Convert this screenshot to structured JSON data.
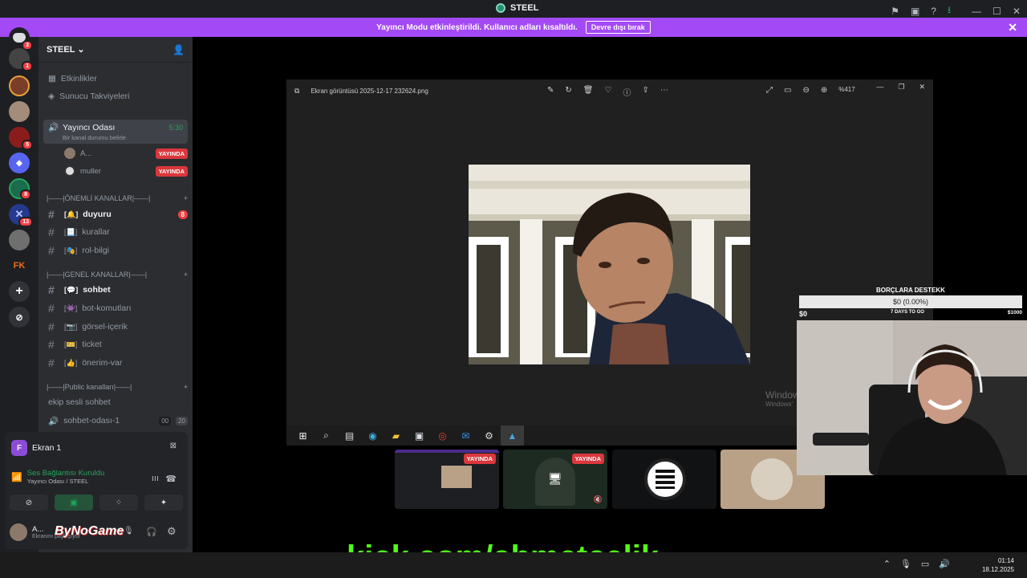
{
  "window": {
    "title": "STEEL"
  },
  "banner": {
    "text": "Yayıncı Modu etkinleştirildi. Kullanıcı adları kısaltıldı.",
    "button": "Devre dışı bırak"
  },
  "guilds": [
    {
      "badge": "3",
      "color": "#5865f2",
      "label": "D"
    },
    {
      "badge": "1",
      "color": "#3a3a3a",
      "label": ""
    },
    {
      "badge": "",
      "color": "#6b3030",
      "label": ""
    },
    {
      "badge": "",
      "color": "#8a6a50",
      "label": ""
    },
    {
      "badge": "5",
      "color": "#7a1515",
      "label": ""
    },
    {
      "badge": "",
      "color": "#23a55a",
      "label": ""
    },
    {
      "badge": "8",
      "color": "#2e7d5b",
      "label": ""
    },
    {
      "badge": "13",
      "color": "#2b3f8f",
      "label": ""
    },
    {
      "badge": "",
      "color": "#777",
      "label": ""
    },
    {
      "badge": "",
      "color": "#c84b1b",
      "label": "FK"
    }
  ],
  "sidebar": {
    "server_name": "STEEL",
    "events": "Etkinlikler",
    "boosts": "Sunucu Takviyeleri",
    "voice_room": {
      "name": "Yayıncı Odası",
      "time": "5:30",
      "status": "Bir kanal durumu belirle"
    },
    "voice_users": [
      {
        "name": "A...",
        "badge": "YAYINDA"
      },
      {
        "name": "muller",
        "badge": "YAYINDA"
      }
    ],
    "cat1": "|——|ÖNEMLİ KANALLAR|——|",
    "channels1": [
      {
        "name": "duyuru",
        "emoji": "🔔",
        "bold": true,
        "count": "8"
      },
      {
        "name": "kurallar",
        "emoji": "📃",
        "bold": false,
        "count": ""
      },
      {
        "name": "rol-bilgi",
        "emoji": "🎭",
        "bold": false,
        "count": ""
      }
    ],
    "cat2": "|——|GENEL KANALLAR|——|",
    "channels2": [
      {
        "name": "sohbet",
        "emoji": "💬",
        "bold": true
      },
      {
        "name": "bot-komutları",
        "emoji": "👾",
        "bold": false
      },
      {
        "name": "görsel-içerik",
        "emoji": "📷",
        "bold": false
      },
      {
        "name": "ticket",
        "emoji": "🎫",
        "bold": false
      },
      {
        "name": "önerim-var",
        "emoji": "👍",
        "bold": false
      }
    ],
    "cat3": "|——|Public kanalları|——|",
    "voice_channels": [
      {
        "name": "ekip sesli sohbet"
      },
      {
        "name": "sohbet-odası-1",
        "a": "00",
        "b": "20"
      }
    ]
  },
  "voice_panel": {
    "screen": "Ekran 1",
    "connection": "Ses Bağlantısı Kuruldu",
    "location": "Yayıncı Odası / STEEL",
    "user": "A...",
    "user_status": "Ekranını paylaşıyor",
    "watermark": "ByNoGame"
  },
  "viewer": {
    "filename": "Ekran görüntüsü 2025-12-17 232624.png",
    "zoom": "%417",
    "windows_text": "Window",
    "windows_text2": "Windows'"
  },
  "thumbs": [
    {
      "badge": "YAYINDA"
    },
    {
      "badge": "YAYINDA"
    },
    {
      "badge": ""
    },
    {
      "badge": ""
    }
  ],
  "donation": {
    "title": "BORÇLARA DESTEKK",
    "amount": "$0 (0.00%)",
    "start": "$0",
    "days": "7 DAYS TO GO",
    "goal": "$1000",
    "progress": 0.0
  },
  "overlay": {
    "kick": "kick.com/ahmetceljk"
  },
  "system_tray": {
    "time": "01:14",
    "date": "18.12.2025"
  }
}
